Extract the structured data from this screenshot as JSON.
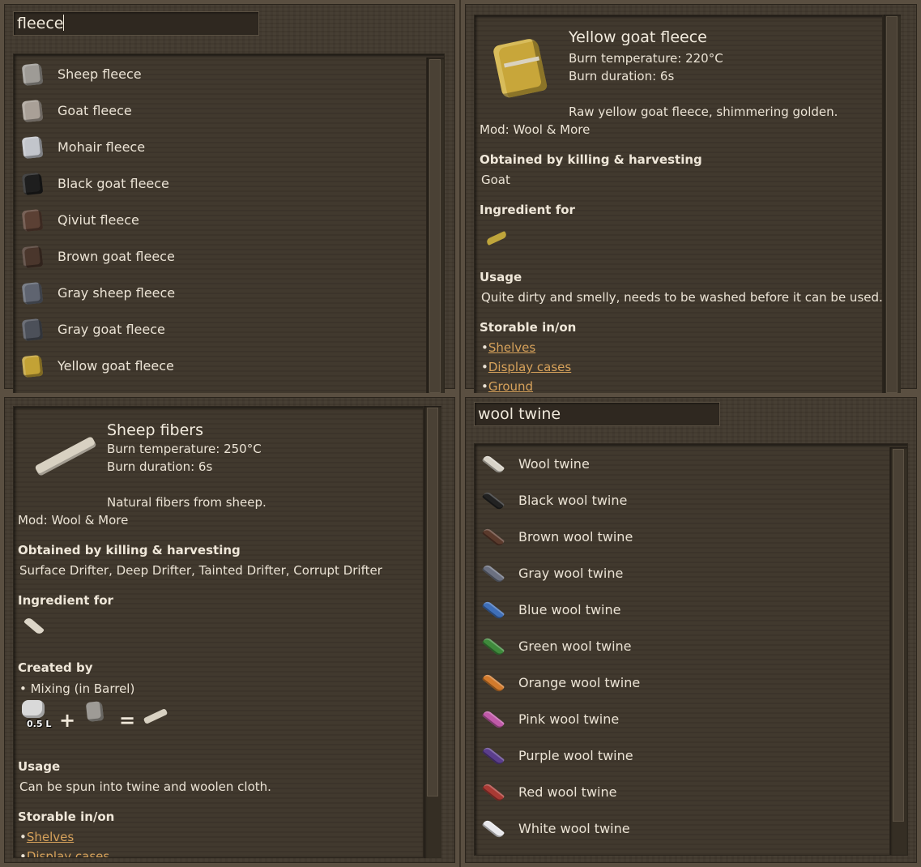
{
  "top_left": {
    "search_value": "fleece",
    "items": [
      {
        "label": "Sheep fleece",
        "color": "#9e9b96"
      },
      {
        "label": "Goat fleece",
        "color": "#a9a097"
      },
      {
        "label": "Mohair fleece",
        "color": "#c2c5cb"
      },
      {
        "label": "Black goat fleece",
        "color": "#1e1e1e"
      },
      {
        "label": "Qiviut fleece",
        "color": "#5b4034"
      },
      {
        "label": "Brown goat fleece",
        "color": "#4a362c"
      },
      {
        "label": "Gray sheep fleece",
        "color": "#5f6470"
      },
      {
        "label": "Gray goat fleece",
        "color": "#4c5059"
      },
      {
        "label": "Yellow goat fleece",
        "color": "#c3a235"
      }
    ]
  },
  "top_right": {
    "title": "Yellow goat fleece",
    "burn_temperature": "Burn temperature: 220°C",
    "burn_duration": "Burn duration: 6s",
    "description": "Raw yellow goat fleece, shimmering golden.",
    "mod": "Mod: Wool & More",
    "obtained_heading": "Obtained by killing & harvesting",
    "obtained_value": "Goat",
    "ingredient_heading": "Ingredient for",
    "usage_heading": "Usage",
    "usage_value": "Quite dirty and smelly, needs to be washed before it can be used.",
    "storable_heading": "Storable in/on",
    "storable": [
      "Shelves",
      "Display cases",
      "Ground"
    ]
  },
  "bottom_left": {
    "title": "Sheep fibers",
    "burn_temperature": "Burn temperature: 250°C",
    "burn_duration": "Burn duration: 6s",
    "description": "Natural fibers from sheep.",
    "mod": "Mod: Wool & More",
    "obtained_heading": "Obtained by killing & harvesting",
    "obtained_value": "Surface Drifter, Deep Drifter, Tainted Drifter, Corrupt Drifter",
    "ingredient_heading": "Ingredient for",
    "created_heading": "Created by",
    "created_method": "• Mixing (in Barrel)",
    "recipe_qty": "0.5 L",
    "recipe_plus": "+",
    "recipe_equals": "=",
    "usage_heading": "Usage",
    "usage_value": "Can be spun into twine and woolen cloth.",
    "storable_heading": "Storable in/on",
    "storable": [
      "Shelves",
      "Display cases"
    ]
  },
  "bottom_right": {
    "search_value": "wool twine",
    "items": [
      {
        "label": "Wool twine",
        "color": "#d8d3c8"
      },
      {
        "label": "Black wool twine",
        "color": "#222222"
      },
      {
        "label": "Brown wool twine",
        "color": "#5b3a2c"
      },
      {
        "label": "Gray wool twine",
        "color": "#6b7080"
      },
      {
        "label": "Blue wool twine",
        "color": "#3f6fb8"
      },
      {
        "label": "Green wool twine",
        "color": "#3f8a3c"
      },
      {
        "label": "Orange wool twine",
        "color": "#d27a2c"
      },
      {
        "label": "Pink wool twine",
        "color": "#c05aa8"
      },
      {
        "label": "Purple wool twine",
        "color": "#5b3e8c"
      },
      {
        "label": "Red wool twine",
        "color": "#a83a34"
      },
      {
        "label": "White wool twine",
        "color": "#e8e8ec"
      }
    ]
  }
}
